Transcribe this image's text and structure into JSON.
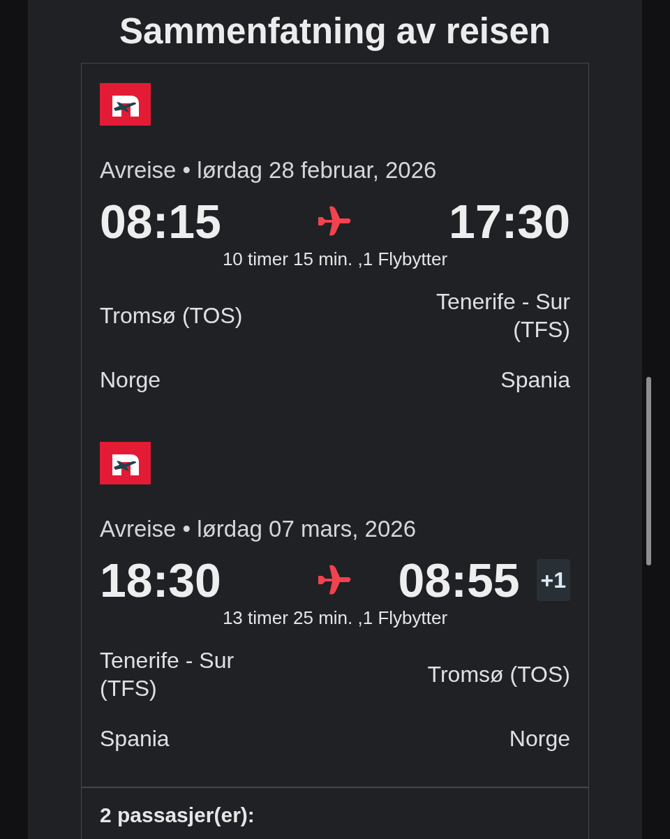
{
  "title": "Sammenfatning av reisen",
  "segments": [
    {
      "departure_info": "Avreise • lørdag 28 februar, 2026",
      "departure_time": "08:15",
      "arrival_time": "17:30",
      "duration": "10 timer 15 min. ,1 Flybytter",
      "origin": {
        "airport": "Tromsø (TOS)",
        "country": "Norge"
      },
      "destination": {
        "airport": "Tenerife - Sur (TFS)",
        "country": "Spania"
      }
    },
    {
      "departure_info": "Avreise • lørdag 07 mars, 2026",
      "departure_time": "18:30",
      "arrival_time": "08:55",
      "day_offset": "+1",
      "duration": "13 timer 25 min. ,1 Flybytter",
      "origin": {
        "airport": "Tenerife - Sur (TFS)",
        "country": "Spania"
      },
      "destination": {
        "airport": "Tromsø (TOS)",
        "country": "Norge"
      }
    }
  ],
  "passengers": "2 passasjer(er):"
}
